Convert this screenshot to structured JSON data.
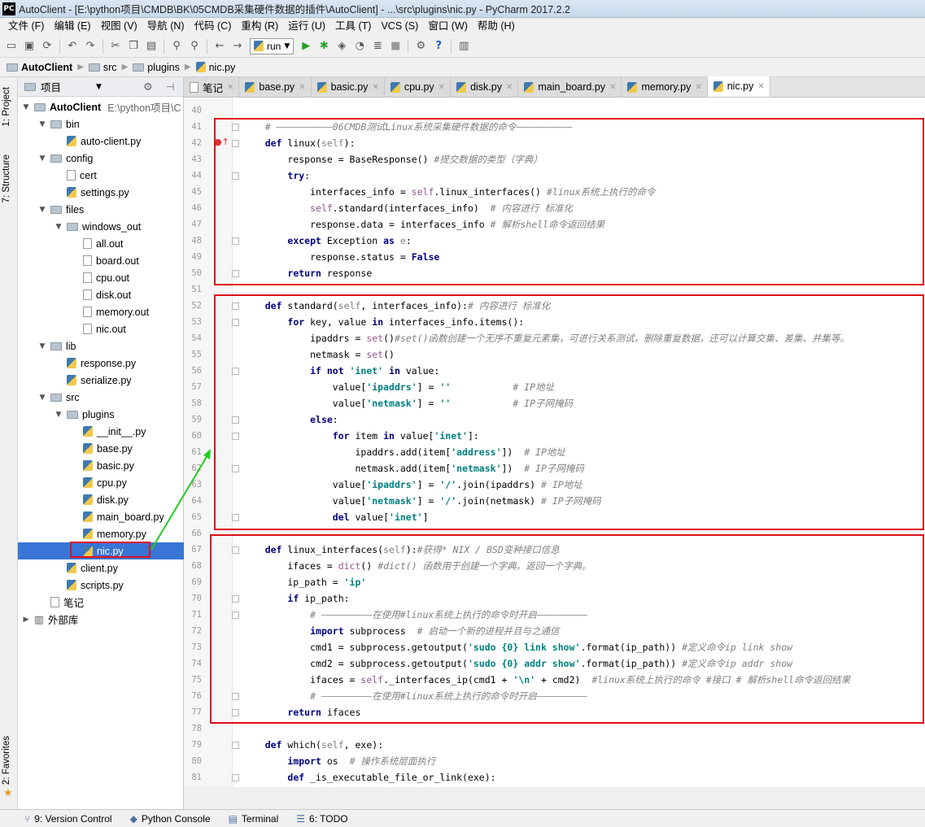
{
  "window": {
    "title": "AutoClient - [E:\\python项目\\CMDB\\BK\\05CMDB采集硬件数据的插件\\AutoClient] - ...\\src\\plugins\\nic.py - PyCharm 2017.2.2",
    "app_icon": "PC"
  },
  "menu": [
    "文件 (F)",
    "编辑 (E)",
    "视图 (V)",
    "导航 (N)",
    "代码 (C)",
    "重构 (R)",
    "运行 (U)",
    "工具 (T)",
    "VCS (S)",
    "窗口 (W)",
    "帮助 (H)"
  ],
  "toolbar": {
    "run_config": "run"
  },
  "breadcrumb": [
    "AutoClient",
    "src",
    "plugins",
    "nic.py"
  ],
  "left_strip": {
    "project": "1: Project",
    "structure": "7: Structure",
    "favorites": "2: Favorites"
  },
  "project_panel": {
    "title": "项目",
    "tree": [
      {
        "label": "AutoClient",
        "hint": "E:\\python项目\\C",
        "depth": 0,
        "type": "folder",
        "expanded": true,
        "bold": true
      },
      {
        "label": "bin",
        "depth": 1,
        "type": "folder",
        "expanded": true
      },
      {
        "label": "auto-client.py",
        "depth": 2,
        "type": "py"
      },
      {
        "label": "config",
        "depth": 1,
        "type": "folder",
        "expanded": true
      },
      {
        "label": "cert",
        "depth": 2,
        "type": "txt"
      },
      {
        "label": "settings.py",
        "depth": 2,
        "type": "py"
      },
      {
        "label": "files",
        "depth": 1,
        "type": "folder",
        "expanded": true
      },
      {
        "label": "windows_out",
        "depth": 2,
        "type": "folder",
        "expanded": true
      },
      {
        "label": "all.out",
        "depth": 3,
        "type": "txt"
      },
      {
        "label": "board.out",
        "depth": 3,
        "type": "txt"
      },
      {
        "label": "cpu.out",
        "depth": 3,
        "type": "txt"
      },
      {
        "label": "disk.out",
        "depth": 3,
        "type": "txt"
      },
      {
        "label": "memory.out",
        "depth": 3,
        "type": "txt"
      },
      {
        "label": "nic.out",
        "depth": 3,
        "type": "txt"
      },
      {
        "label": "lib",
        "depth": 1,
        "type": "folder",
        "expanded": true
      },
      {
        "label": "response.py",
        "depth": 2,
        "type": "py"
      },
      {
        "label": "serialize.py",
        "depth": 2,
        "type": "py"
      },
      {
        "label": "src",
        "depth": 1,
        "type": "folder",
        "expanded": true
      },
      {
        "label": "plugins",
        "depth": 2,
        "type": "folder",
        "expanded": true
      },
      {
        "label": "__init__.py",
        "depth": 3,
        "type": "py"
      },
      {
        "label": "base.py",
        "depth": 3,
        "type": "py"
      },
      {
        "label": "basic.py",
        "depth": 3,
        "type": "py"
      },
      {
        "label": "cpu.py",
        "depth": 3,
        "type": "py"
      },
      {
        "label": "disk.py",
        "depth": 3,
        "type": "py"
      },
      {
        "label": "main_board.py",
        "depth": 3,
        "type": "py"
      },
      {
        "label": "memory.py",
        "depth": 3,
        "type": "py"
      },
      {
        "label": "nic.py",
        "depth": 3,
        "type": "py",
        "selected": true
      },
      {
        "label": "client.py",
        "depth": 2,
        "type": "py"
      },
      {
        "label": "scripts.py",
        "depth": 2,
        "type": "py"
      },
      {
        "label": "笔记",
        "depth": 1,
        "type": "txt"
      },
      {
        "label": "外部库",
        "depth": 0,
        "type": "lib",
        "expanded": false
      }
    ]
  },
  "tabs": [
    {
      "label": "笔记",
      "type": "txt"
    },
    {
      "label": "base.py",
      "type": "py"
    },
    {
      "label": "basic.py",
      "type": "py"
    },
    {
      "label": "cpu.py",
      "type": "py"
    },
    {
      "label": "disk.py",
      "type": "py"
    },
    {
      "label": "main_board.py",
      "type": "py"
    },
    {
      "label": "memory.py",
      "type": "py"
    },
    {
      "label": "nic.py",
      "type": "py",
      "active": true
    }
  ],
  "code": [
    {
      "n": "40",
      "t": []
    },
    {
      "n": "41",
      "t": [
        [
          "    ",
          ""
        ],
        [
          "# ——————————06CMDB测试Linux系统采集硬件数据的命令——————————",
          "cm"
        ]
      ]
    },
    {
      "n": "42",
      "t": [
        [
          "    ",
          ""
        ],
        [
          "def ",
          "kw"
        ],
        [
          "linux(",
          ""
        ],
        [
          "self",
          "pm"
        ],
        [
          "):",
          ""
        ]
      ]
    },
    {
      "n": "43",
      "t": [
        [
          "        response = BaseResponse() ",
          ""
        ],
        [
          "#提交数据的类型（字典）",
          "cm"
        ]
      ]
    },
    {
      "n": "44",
      "t": [
        [
          "        ",
          ""
        ],
        [
          "try",
          "kw"
        ],
        [
          ":",
          ""
        ]
      ]
    },
    {
      "n": "45",
      "t": [
        [
          "            interfaces_info = ",
          ""
        ],
        [
          "self",
          "sf"
        ],
        [
          ".linux_interfaces() ",
          ""
        ],
        [
          "#linux系统上执行的命令",
          "cm"
        ]
      ]
    },
    {
      "n": "46",
      "t": [
        [
          "            ",
          ""
        ],
        [
          "self",
          "sf"
        ],
        [
          ".standard(interfaces_info)  ",
          ""
        ],
        [
          "# 内容进行 标准化",
          "cm"
        ]
      ]
    },
    {
      "n": "47",
      "t": [
        [
          "            response.data = interfaces_info ",
          ""
        ],
        [
          "# 解析shell命令返回结果",
          "cm"
        ]
      ]
    },
    {
      "n": "48",
      "t": [
        [
          "        ",
          ""
        ],
        [
          "except ",
          "kw"
        ],
        [
          "Exception ",
          ""
        ],
        [
          "as ",
          "kw"
        ],
        [
          "e",
          "pm"
        ],
        [
          ":",
          ""
        ]
      ]
    },
    {
      "n": "49",
      "t": [
        [
          "            response.status = ",
          ""
        ],
        [
          "False",
          "kw"
        ]
      ]
    },
    {
      "n": "50",
      "t": [
        [
          "        ",
          ""
        ],
        [
          "return ",
          "kw"
        ],
        [
          "response",
          ""
        ]
      ]
    },
    {
      "n": "51",
      "t": []
    },
    {
      "n": "52",
      "t": [
        [
          "    ",
          ""
        ],
        [
          "def ",
          "kw"
        ],
        [
          "standard(",
          ""
        ],
        [
          "self",
          "pm"
        ],
        [
          ", interfaces_info):",
          ""
        ],
        [
          "# 内容进行 标准化",
          "cm"
        ]
      ]
    },
    {
      "n": "53",
      "t": [
        [
          "        ",
          ""
        ],
        [
          "for ",
          "kw"
        ],
        [
          "key, value ",
          ""
        ],
        [
          "in ",
          "kw"
        ],
        [
          "interfaces_info.items():",
          ""
        ]
      ]
    },
    {
      "n": "54",
      "t": [
        [
          "            ipaddrs = ",
          ""
        ],
        [
          "set",
          "sf"
        ],
        [
          "()",
          ""
        ],
        [
          "#set()函数创建一个无序不重复元素集，可进行关系测试，删除重复数据，还可以计算交集、差集、并集等。",
          "cm"
        ]
      ]
    },
    {
      "n": "55",
      "t": [
        [
          "            netmask = ",
          ""
        ],
        [
          "set",
          "sf"
        ],
        [
          "()",
          ""
        ]
      ]
    },
    {
      "n": "56",
      "t": [
        [
          "            ",
          ""
        ],
        [
          "if not ",
          "kw"
        ],
        [
          "'inet' ",
          "st"
        ],
        [
          "in ",
          "kw"
        ],
        [
          "value:",
          ""
        ]
      ]
    },
    {
      "n": "57",
      "t": [
        [
          "                value[",
          ""
        ],
        [
          "'ipaddrs'",
          "st"
        ],
        [
          "] = ",
          ""
        ],
        [
          "''",
          "st"
        ],
        [
          "           ",
          ""
        ],
        [
          "# IP地址",
          "cm"
        ]
      ]
    },
    {
      "n": "58",
      "t": [
        [
          "                value[",
          ""
        ],
        [
          "'netmask'",
          "st"
        ],
        [
          "] = ",
          ""
        ],
        [
          "''",
          "st"
        ],
        [
          "           ",
          ""
        ],
        [
          "# IP子网掩码",
          "cm"
        ]
      ]
    },
    {
      "n": "59",
      "t": [
        [
          "            ",
          ""
        ],
        [
          "else",
          "kw"
        ],
        [
          ":",
          ""
        ]
      ]
    },
    {
      "n": "60",
      "t": [
        [
          "                ",
          ""
        ],
        [
          "for ",
          "kw"
        ],
        [
          "item ",
          ""
        ],
        [
          "in ",
          "kw"
        ],
        [
          "value[",
          ""
        ],
        [
          "'inet'",
          "st"
        ],
        [
          "]:",
          ""
        ]
      ]
    },
    {
      "n": "61",
      "t": [
        [
          "                    ipaddrs.add(item[",
          ""
        ],
        [
          "'address'",
          "st"
        ],
        [
          "])  ",
          ""
        ],
        [
          "# IP地址",
          "cm"
        ]
      ]
    },
    {
      "n": "62",
      "t": [
        [
          "                    netmask.add(item[",
          ""
        ],
        [
          "'netmask'",
          "st"
        ],
        [
          "])  ",
          ""
        ],
        [
          "# IP子网掩码",
          "cm"
        ]
      ]
    },
    {
      "n": "63",
      "t": [
        [
          "                value[",
          ""
        ],
        [
          "'ipaddrs'",
          "st"
        ],
        [
          "] = ",
          ""
        ],
        [
          "'/'",
          "st"
        ],
        [
          ".join(ipaddrs) ",
          ""
        ],
        [
          "# IP地址",
          "cm"
        ]
      ]
    },
    {
      "n": "64",
      "t": [
        [
          "                value[",
          ""
        ],
        [
          "'netmask'",
          "st"
        ],
        [
          "] = ",
          ""
        ],
        [
          "'/'",
          "st"
        ],
        [
          ".join(netmask) ",
          ""
        ],
        [
          "# IP子网掩码",
          "cm"
        ]
      ]
    },
    {
      "n": "65",
      "t": [
        [
          "                ",
          ""
        ],
        [
          "del ",
          "kw"
        ],
        [
          "value[",
          ""
        ],
        [
          "'inet'",
          "st"
        ],
        [
          "]",
          ""
        ]
      ]
    },
    {
      "n": "66",
      "t": []
    },
    {
      "n": "67",
      "t": [
        [
          "    ",
          ""
        ],
        [
          "def ",
          "kw"
        ],
        [
          "linux_interfaces(",
          ""
        ],
        [
          "self",
          "pm"
        ],
        [
          "):",
          ""
        ],
        [
          "#获得* NIX / BSD变种接口信息",
          "cm"
        ]
      ]
    },
    {
      "n": "68",
      "t": [
        [
          "        ifaces = ",
          ""
        ],
        [
          "dict",
          "sf"
        ],
        [
          "() ",
          ""
        ],
        [
          "#dict() 函数用于创建一个字典。返回一个字典。",
          "cm"
        ]
      ]
    },
    {
      "n": "69",
      "t": [
        [
          "        ip_path = ",
          ""
        ],
        [
          "'ip'",
          "st"
        ]
      ]
    },
    {
      "n": "70",
      "t": [
        [
          "        ",
          ""
        ],
        [
          "if ",
          "kw"
        ],
        [
          "ip_path:",
          ""
        ]
      ]
    },
    {
      "n": "71",
      "t": [
        [
          "            ",
          ""
        ],
        [
          "# —————————在使用#linux系统上执行的命令时开启—————————",
          "cm"
        ]
      ]
    },
    {
      "n": "72",
      "t": [
        [
          "            ",
          ""
        ],
        [
          "import ",
          "kw"
        ],
        [
          "subprocess  ",
          ""
        ],
        [
          "# 启动一个新的进程并且与之通信",
          "cm"
        ]
      ]
    },
    {
      "n": "73",
      "t": [
        [
          "            cmd1 = subprocess.getoutput(",
          ""
        ],
        [
          "'sudo {0} link show'",
          "st"
        ],
        [
          ".format(ip_path)) ",
          ""
        ],
        [
          "#定义命令ip link show",
          "cm"
        ]
      ]
    },
    {
      "n": "74",
      "t": [
        [
          "            cmd2 = subprocess.getoutput(",
          ""
        ],
        [
          "'sudo {0} addr show'",
          "st"
        ],
        [
          ".format(ip_path)) ",
          ""
        ],
        [
          "#定义命令ip addr show",
          "cm"
        ]
      ]
    },
    {
      "n": "75",
      "t": [
        [
          "            ifaces = ",
          ""
        ],
        [
          "self",
          "sf"
        ],
        [
          "._interfaces_ip(cmd1 + ",
          ""
        ],
        [
          "'\\n'",
          "st"
        ],
        [
          " + cmd2)  ",
          ""
        ],
        [
          "#linux系统上执行的命令 #接口 # 解析shell命令返回结果",
          "cm"
        ]
      ]
    },
    {
      "n": "76",
      "t": [
        [
          "            ",
          ""
        ],
        [
          "# —————————在使用#linux系统上执行的命令时开启—————————",
          "cm"
        ]
      ]
    },
    {
      "n": "77",
      "t": [
        [
          "        ",
          ""
        ],
        [
          "return ",
          "kw"
        ],
        [
          "ifaces",
          ""
        ]
      ]
    },
    {
      "n": "78",
      "t": []
    },
    {
      "n": "79",
      "t": [
        [
          "    ",
          ""
        ],
        [
          "def ",
          "kw"
        ],
        [
          "which(",
          ""
        ],
        [
          "self",
          "pm"
        ],
        [
          ", exe):",
          ""
        ]
      ]
    },
    {
      "n": "80",
      "t": [
        [
          "        ",
          ""
        ],
        [
          "import ",
          "kw"
        ],
        [
          "os  ",
          ""
        ],
        [
          "# 操作系统层面执行",
          "cm"
        ]
      ]
    },
    {
      "n": "81",
      "t": [
        [
          "        ",
          ""
        ],
        [
          "def ",
          "kw"
        ],
        [
          "_is_executable_file_or_link(exe):",
          ""
        ]
      ]
    }
  ],
  "bottom_tools": [
    {
      "label": "9: Version Control",
      "icon": "version-control-icon"
    },
    {
      "label": "Python Console",
      "icon": "python-console-icon"
    },
    {
      "label": "Terminal",
      "icon": "terminal-icon"
    },
    {
      "label": "6: TODO",
      "icon": "todo-icon"
    }
  ],
  "annotation_colors": {
    "highlight_box": "#e0101a",
    "pointer_arrow": "#22cc22"
  }
}
